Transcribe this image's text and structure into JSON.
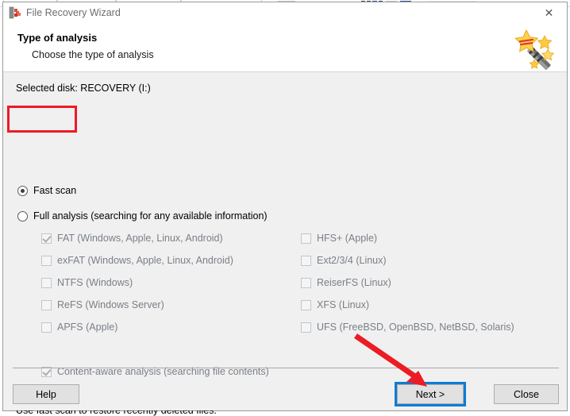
{
  "background_app": {
    "visible": true,
    "description": "partially visible ribbon of an application window behind the dialog"
  },
  "window": {
    "title": "File Recovery Wizard",
    "app_icon": "file-recovery-app-icon",
    "close_icon": "close-icon",
    "close_label": "✕"
  },
  "header": {
    "title": "Type of analysis",
    "subtitle": "Choose the type of analysis",
    "art_icon": "magic-wand-icon"
  },
  "body": {
    "selected_disk_label": "Selected disk: RECOVERY (I:)",
    "scan_modes": [
      {
        "label": "Fast scan",
        "checked": true
      },
      {
        "label": "Full analysis (searching for any available information)",
        "checked": false
      }
    ],
    "filesystems_left": [
      {
        "label": "FAT (Windows, Apple, Linux, Android)",
        "checked": true,
        "disabled": true
      },
      {
        "label": "exFAT (Windows, Apple, Linux, Android)",
        "checked": false,
        "disabled": true
      },
      {
        "label": "NTFS (Windows)",
        "checked": false,
        "disabled": true
      },
      {
        "label": "ReFS (Windows Server)",
        "checked": false,
        "disabled": true
      },
      {
        "label": "APFS (Apple)",
        "checked": false,
        "disabled": true
      }
    ],
    "filesystems_right": [
      {
        "label": "HFS+ (Apple)",
        "checked": false,
        "disabled": true
      },
      {
        "label": "Ext2/3/4 (Linux)",
        "checked": false,
        "disabled": true
      },
      {
        "label": "ReiserFS (Linux)",
        "checked": false,
        "disabled": true
      },
      {
        "label": "XFS (Linux)",
        "checked": false,
        "disabled": true
      },
      {
        "label": "UFS (FreeBSD, OpenBSD, NetBSD, Solaris)",
        "checked": false,
        "disabled": true
      }
    ],
    "content_aware": {
      "label": "Content-aware analysis (searching file contents)",
      "checked": true,
      "disabled": true
    },
    "hint": "Use fast scan to restore recently deleted files."
  },
  "footer": {
    "help_label": "Help",
    "next_label": "Next >",
    "close_label": "Close"
  },
  "annotations": {
    "highlight_target": "Fast scan",
    "arrow_target": "Next >",
    "color": "#ec1b24"
  },
  "colors": {
    "dialog_background": "#f0f0f0",
    "header_background": "#ffffff",
    "focus_blue": "#0c7cd5",
    "annotation_red": "#ec1b24",
    "disabled_text": "#7a7f86"
  }
}
